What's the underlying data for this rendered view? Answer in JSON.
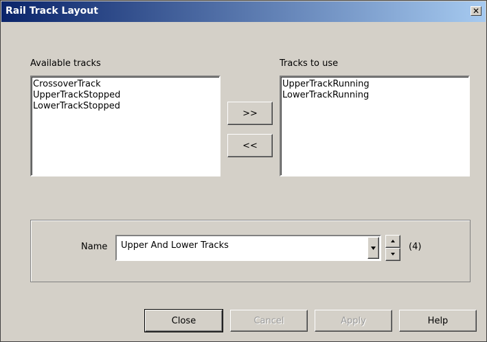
{
  "window": {
    "title": "Rail Track Layout"
  },
  "available": {
    "label": "Available tracks",
    "items": [
      "CrossoverTrack",
      "UpperTrackStopped",
      "LowerTrackStopped"
    ]
  },
  "to_use": {
    "label": "Tracks to use",
    "items": [
      "UpperTrackRunning",
      "LowerTrackRunning"
    ]
  },
  "move": {
    "add_label": ">>",
    "remove_label": "<<"
  },
  "name": {
    "label": "Name",
    "value": "Upper And Lower Tracks",
    "count": "(4)"
  },
  "footer": {
    "close": "Close",
    "cancel": "Cancel",
    "apply": "Apply",
    "help": "Help"
  }
}
